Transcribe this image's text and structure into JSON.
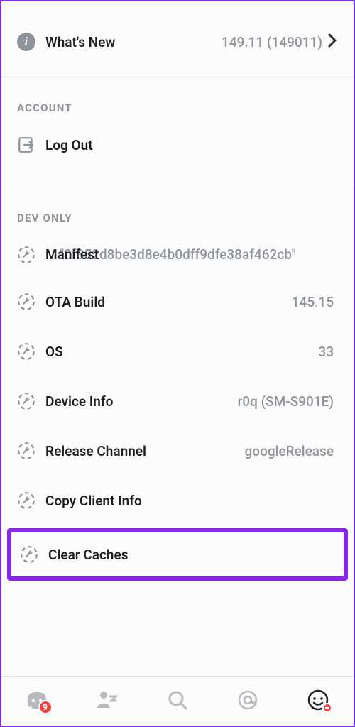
{
  "whats_new": {
    "label": "What's New",
    "value": "149.11 (149011)"
  },
  "sections": {
    "account": {
      "header": "ACCOUNT",
      "logout_label": "Log Out"
    },
    "dev": {
      "header": "DEV ONLY",
      "manifest": {
        "label": "Manifest",
        "value": "\"0f352d8be3d8e4b0dff9dfe38af462cb\""
      },
      "ota": {
        "label": "OTA Build",
        "value": "145.15"
      },
      "os": {
        "label": "OS",
        "value": "33"
      },
      "device": {
        "label": "Device Info",
        "value": "r0q (SM-S901E)"
      },
      "release": {
        "label": "Release Channel",
        "value": "googleRelease"
      },
      "copy": {
        "label": "Copy Client Info"
      },
      "clear": {
        "label": "Clear Caches"
      }
    }
  },
  "nav": {
    "discord_badge": "9"
  }
}
